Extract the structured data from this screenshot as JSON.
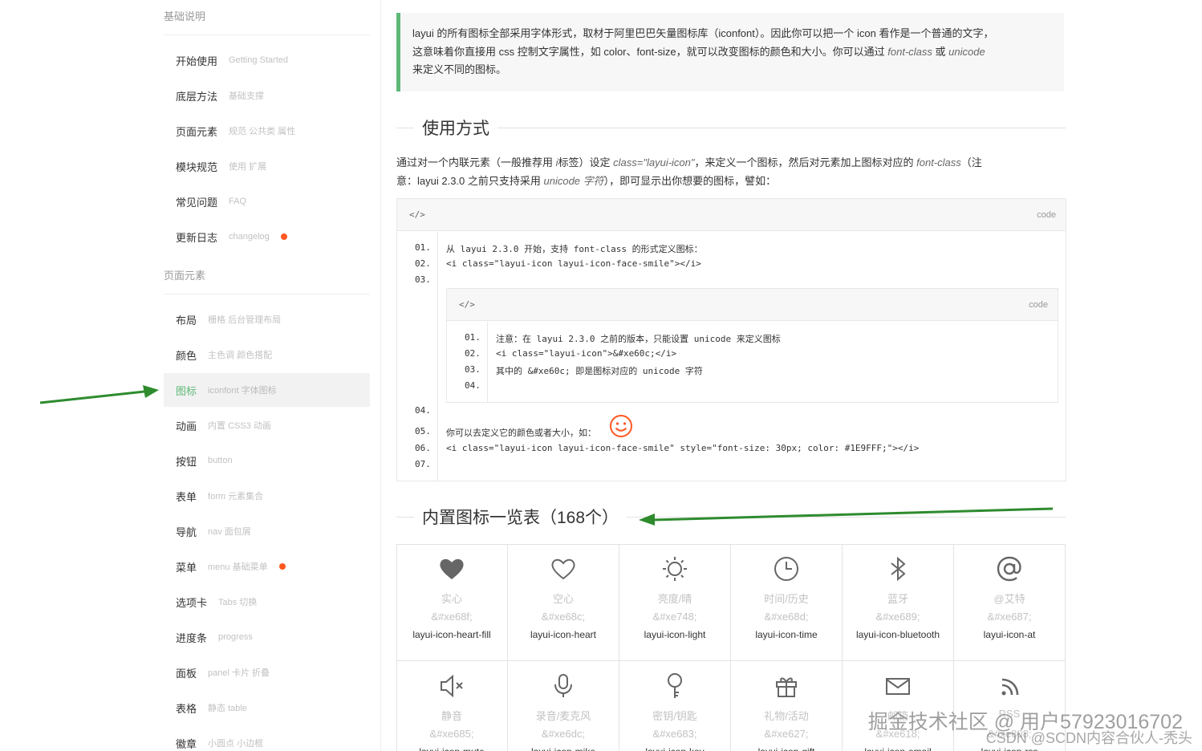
{
  "sidebar": {
    "section1": "基础说明",
    "items1": [
      {
        "label": "开始使用",
        "sub": "Getting Started"
      },
      {
        "label": "底层方法",
        "sub": "基础支撑"
      },
      {
        "label": "页面元素",
        "sub": "规范 公共类 属性"
      },
      {
        "label": "模块规范",
        "sub": "使用 扩展"
      },
      {
        "label": "常见问题",
        "sub": "FAQ"
      },
      {
        "label": "更新日志",
        "sub": "changelog"
      }
    ],
    "section2": "页面元素",
    "items2": [
      {
        "label": "布局",
        "sub": "栅格 后台管理布局"
      },
      {
        "label": "颜色",
        "sub": "主色调 颜色搭配"
      },
      {
        "label": "图标",
        "sub": "iconfont 字体图标"
      },
      {
        "label": "动画",
        "sub": "内置 CSS3 动画"
      },
      {
        "label": "按钮",
        "sub": "button"
      },
      {
        "label": "表单",
        "sub": "form 元素集合"
      },
      {
        "label": "导航",
        "sub": "nav 面包屑"
      },
      {
        "label": "菜单",
        "sub": "menu 基础菜单"
      },
      {
        "label": "选项卡",
        "sub": "Tabs 切换"
      },
      {
        "label": "进度条",
        "sub": "progress"
      },
      {
        "label": "面板",
        "sub": "panel 卡片 折叠"
      },
      {
        "label": "表格",
        "sub": "静态 table"
      },
      {
        "label": "徽章",
        "sub": "小圆点 小边框"
      }
    ]
  },
  "notice": {
    "line1": "layui 的所有图标全部采用字体形式，取材于阿里巴巴矢量图标库（iconfont）。因此你可以把一个 icon 看作是一个普通的文字，",
    "line2a": "这意味着你直接用 css 控制文字属性，如 color、font-size，就可以改变图标的颜色和大小。你可以通过 ",
    "line2em1": "font-class",
    "line2b": " 或 ",
    "line2em2": "unicode",
    "line3": "来定义不同的图标。"
  },
  "usage_title": "使用方式",
  "desc": {
    "p1": "通过对一个内联元素（一般推荐用 ",
    "p1em1": "i",
    "p1b": "标签）设定 ",
    "p1em2": "class=\"layui-icon\"",
    "p1c": "，来定义一个图标，然后对元素加上图标对应的 ",
    "p1em3": "font-class",
    "p1d": "（注",
    "p2": "意：layui 2.3.0 之前只支持采用 ",
    "p2em": "unicode 字符",
    "p2b": "），即可显示出你想要的图标，譬如："
  },
  "code": {
    "head": "</>",
    "tag": "code",
    "lines": [
      "01.",
      "02.",
      "03.",
      "04.",
      "05.",
      "06.",
      "07."
    ],
    "l1": "从 layui 2.3.0 开始，支持 font-class 的形式定义图标：",
    "l2": "<i class=\"layui-icon layui-icon-face-smile\"></i>",
    "l5": "你可以去定义它的颜色或者大小，如：",
    "l6": "<i class=\"layui-icon layui-icon-face-smile\" style=\"font-size: 30px; color: #1E9FFF;\"></i>",
    "inner": {
      "head": "</>",
      "tag": "code",
      "lines": [
        "01.",
        "02.",
        "03.",
        "04."
      ],
      "l1": "注意：在 layui 2.3.0 之前的版本，只能设置 unicode 来定义图标",
      "l2": "<i class=\"layui-icon\">&#xe60c;</i>",
      "l3": "其中的 &#xe60c; 即是图标对应的 unicode 字符"
    }
  },
  "builtin_title": "内置图标一览表（168个）",
  "icons": [
    {
      "name": "实心",
      "unicode": "&#xe68f;",
      "cls": "layui-icon-heart-fill"
    },
    {
      "name": "空心",
      "unicode": "&#xe68c;",
      "cls": "layui-icon-heart"
    },
    {
      "name": "亮度/晴",
      "unicode": "&#xe748;",
      "cls": "layui-icon-light"
    },
    {
      "name": "时间/历史",
      "unicode": "&#xe68d;",
      "cls": "layui-icon-time"
    },
    {
      "name": "蓝牙",
      "unicode": "&#xe689;",
      "cls": "layui-icon-bluetooth"
    },
    {
      "name": "@艾特",
      "unicode": "&#xe687;",
      "cls": "layui-icon-at"
    },
    {
      "name": "静音",
      "unicode": "&#xe685;",
      "cls": "layui-icon-mute"
    },
    {
      "name": "录音/麦克风",
      "unicode": "&#xe6dc;",
      "cls": "layui-icon-mike"
    },
    {
      "name": "密钥/钥匙",
      "unicode": "&#xe683;",
      "cls": "layui-icon-key"
    },
    {
      "name": "礼物/活动",
      "unicode": "&#xe627;",
      "cls": "layui-icon-gift"
    },
    {
      "name": "邮箱",
      "unicode": "&#xe618;",
      "cls": "layui-icon-email"
    },
    {
      "name": "RSS",
      "unicode": "&#xe808;",
      "cls": "layui-icon-rss"
    }
  ],
  "watermark": {
    "line1": "掘金技术社区 @ 用户57923016702",
    "line2": "CSDN @SCDN内容合伙人-秃头"
  },
  "colors": {
    "accent": "#5FB878",
    "dot": "#FF5722",
    "smile": "#FF5722",
    "arrow": "#2E8B2E"
  }
}
